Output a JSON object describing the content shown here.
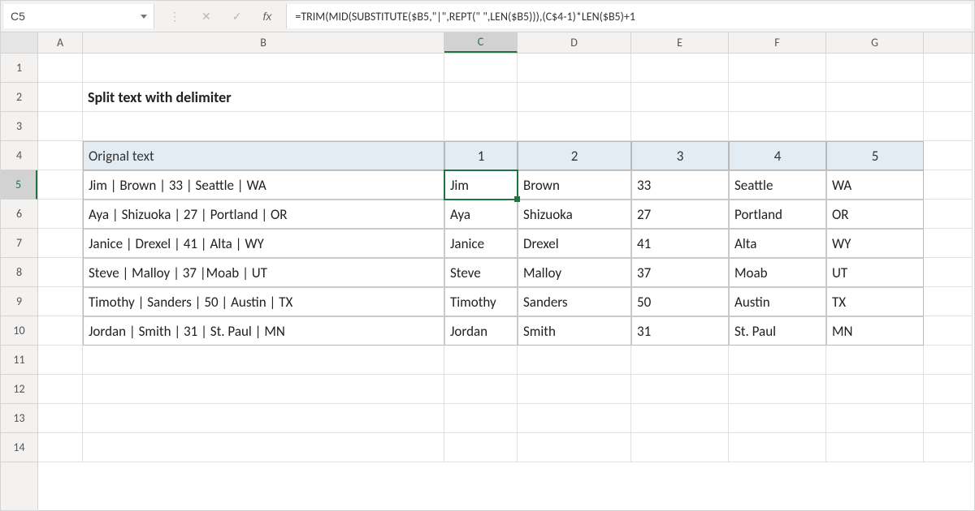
{
  "name_box": "C5",
  "formula": "=TRIM(MID(SUBSTITUTE($B5,\"|\",REPT(\" \",LEN($B5))),(C$4-1)*LEN($B5)+1",
  "icons": {
    "dots": "⋮",
    "cancel": "✕",
    "enter": "✓",
    "fx": "fx"
  },
  "columns": [
    "A",
    "B",
    "C",
    "D",
    "E",
    "F",
    "G"
  ],
  "rows": [
    "1",
    "2",
    "3",
    "4",
    "5",
    "6",
    "7",
    "8",
    "9",
    "10",
    "11",
    "12",
    "13",
    "14"
  ],
  "title": "Split text with delimiter",
  "chart_data": {
    "type": "table",
    "headers": [
      "Orignal text",
      "1",
      "2",
      "3",
      "4",
      "5"
    ],
    "rows": [
      [
        "Jim | Brown | 33 | Seattle | WA",
        "Jim",
        "Brown",
        "33",
        "Seattle",
        "WA"
      ],
      [
        "Aya | Shizuoka | 27 | Portland | OR",
        "Aya",
        "Shizuoka",
        "27",
        "Portland",
        "OR"
      ],
      [
        "Janice | Drexel | 41 | Alta | WY",
        "Janice",
        "Drexel",
        "41",
        "Alta",
        "WY"
      ],
      [
        "Steve | Malloy | 37 |Moab | UT",
        "Steve",
        "Malloy",
        "37",
        "Moab",
        "UT"
      ],
      [
        "Timothy | Sanders | 50 | Austin | TX",
        "Timothy",
        "Sanders",
        "50",
        "Austin",
        "TX"
      ],
      [
        "Jordan | Smith | 31 | St. Paul | MN",
        "Jordan",
        "Smith",
        "31",
        "St. Paul",
        "MN"
      ]
    ]
  },
  "active_cell": {
    "col": "C",
    "row": 5
  }
}
